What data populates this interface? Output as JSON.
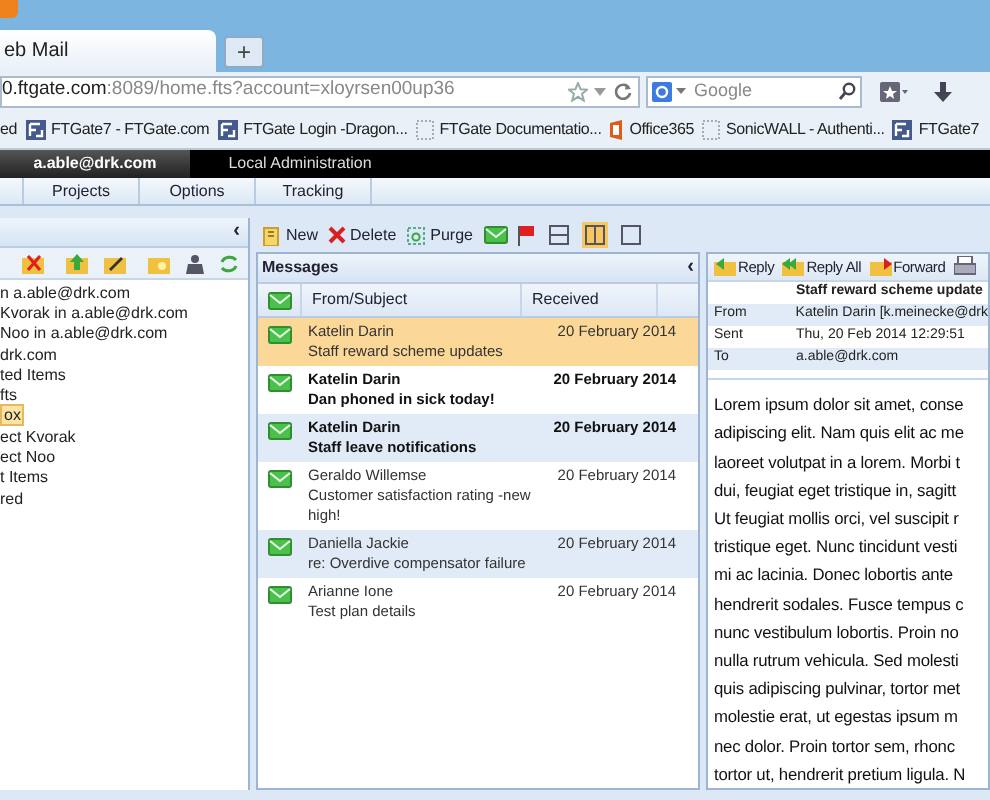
{
  "browser": {
    "tab_title": "eb Mail",
    "new_tab": "+",
    "url_host": "0.ftgate.com",
    "url_rest": ":8089/home.fts?account=xloyrsen00up36",
    "search_placeholder": "Google",
    "bookmarks": [
      {
        "kind": "text",
        "label": "ed"
      },
      {
        "kind": "ftgate",
        "label": "FTGate7 - FTGate.com"
      },
      {
        "kind": "ftgate",
        "label": "FTGate Login -Dragon..."
      },
      {
        "kind": "page",
        "label": "FTGate Documentatio..."
      },
      {
        "kind": "office",
        "label": "Office365"
      },
      {
        "kind": "page",
        "label": "SonicWALL - Authenti..."
      },
      {
        "kind": "ftgate",
        "label": "FTGate7"
      }
    ]
  },
  "account_bar": {
    "account": "a.able@drk.com",
    "admin": "Local Administration"
  },
  "app_tabs": [
    {
      "label": "Projects",
      "selected": false
    },
    {
      "label": "Options",
      "selected": false
    },
    {
      "label": "Tracking",
      "selected": false
    }
  ],
  "folders": {
    "collapse": "‹",
    "items": [
      {
        "label": "n a.able@drk.com",
        "selected": false
      },
      {
        "label": "Kvorak in a.able@drk.com",
        "selected": false
      },
      {
        "label": "Noo in a.able@drk.com",
        "selected": false
      },
      {
        "label": "drk.com",
        "selected": false
      },
      {
        "label": "ted Items",
        "selected": false
      },
      {
        "label": "fts",
        "selected": false
      },
      {
        "label": "ox",
        "selected": true
      },
      {
        "label": "ect Kvorak",
        "selected": false
      },
      {
        "label": "ect Noo",
        "selected": false
      },
      {
        "label": "t Items",
        "selected": false
      },
      {
        "label": "red",
        "selected": false
      }
    ]
  },
  "messages": {
    "toolbar": [
      {
        "kind": "new",
        "label": "New"
      },
      {
        "kind": "delete",
        "label": "Delete"
      },
      {
        "kind": "purge",
        "label": "Purge"
      },
      {
        "kind": "mark"
      },
      {
        "kind": "flag"
      }
    ],
    "layouts": [
      {
        "kind": "horizontal",
        "selected": false
      },
      {
        "kind": "vertical",
        "selected": true
      },
      {
        "kind": "single",
        "selected": false
      }
    ],
    "title": "Messages",
    "collapse": "‹",
    "columns": [
      "From/Subject",
      "Received"
    ],
    "rows": [
      {
        "from": "Katelin Darin",
        "subject": "Staff reward scheme updates",
        "received": "20 February 2014",
        "selected": true,
        "unread": false
      },
      {
        "from": "Katelin Darin",
        "subject": "Dan phoned in sick today!",
        "received": "20 February 2014",
        "selected": false,
        "unread": true
      },
      {
        "from": "Katelin Darin",
        "subject": "Staff leave notifications",
        "received": "20 February 2014",
        "selected": false,
        "unread": true
      },
      {
        "from": "Geraldo Willemse",
        "subject": "Customer satisfaction rating -new high!",
        "received": "20 February 2014",
        "selected": false,
        "unread": false
      },
      {
        "from": "Daniella Jackie",
        "subject": "re: Overdive compensator failure",
        "received": "20 February 2014",
        "selected": false,
        "unread": false
      },
      {
        "from": "Arianne Ione",
        "subject": "Test plan details",
        "received": "20 February 2014",
        "selected": false,
        "unread": false
      }
    ]
  },
  "reader": {
    "actions": [
      {
        "kind": "reply",
        "label": "Reply"
      },
      {
        "kind": "reply_all",
        "label": "Reply All"
      },
      {
        "kind": "forward",
        "label": "Forward"
      },
      {
        "kind": "print"
      }
    ],
    "subject": "Staff reward scheme update",
    "fields": [
      {
        "label": "From",
        "value": "Katelin Darin  [k.meinecke@drk"
      },
      {
        "label": "Sent",
        "value": "Thu, 20 Feb 2014 12:29:51"
      },
      {
        "label": "To",
        "value": "a.able@drk.com"
      }
    ],
    "body_lines": [
      "Lorem ipsum dolor sit amet, conse",
      "adipiscing elit. Nam quis elit ac me",
      "laoreet volutpat in a lorem. Morbi t",
      "dui, feugiat eget tristique in, sagitt",
      "Ut feugiat mollis orci, vel suscipit r",
      "tristique eget. Nunc tincidunt vesti",
      "mi ac lacinia. Donec lobortis ante",
      "hendrerit sodales. Fusce tempus c",
      "nunc vestibulum lobortis. Proin no",
      "nulla rutrum vehicula. Sed molesti",
      "quis adipiscing pulvinar, tortor met",
      "molestie erat, ut egestas ipsum m",
      "nec dolor. Proin tortor sem, rhonc",
      "tortor ut, hendrerit pretium ligula. N"
    ]
  }
}
